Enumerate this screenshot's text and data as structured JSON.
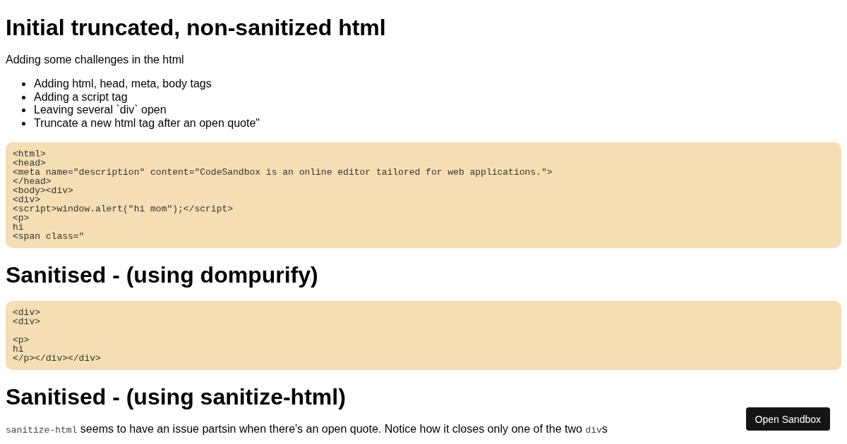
{
  "sections": [
    {
      "heading": "Initial truncated, non-sanitized html",
      "blocks": [
        {
          "kind": "paragraph",
          "parts": [
            {
              "kind": "text",
              "text": "Adding some challenges in the html"
            }
          ]
        },
        {
          "kind": "list",
          "items": [
            "Adding html, head, meta, body tags",
            "Adding a script tag",
            "Leaving several `div` open",
            "Truncate a new html tag after an open quote\""
          ]
        },
        {
          "kind": "code",
          "text": "<html>\n<head>\n<meta name=\"description\" content=\"CodeSandbox is an online editor tailored for web applications.\">\n</head>\n<body><div>\n<div>\n<script>window.alert(\"hi mom\");</script>\n<p>\nhi\n<span class=\""
        }
      ]
    },
    {
      "heading": "Sanitised - (using dompurify)",
      "blocks": [
        {
          "kind": "code",
          "text": "<div>\n<div>\n\n<p>\nhi\n</p></div></div>"
        }
      ]
    },
    {
      "heading": "Sanitised - (using sanitize-html)",
      "blocks": [
        {
          "kind": "paragraph",
          "parts": [
            {
              "kind": "code",
              "text": "sanitize-html"
            },
            {
              "kind": "text",
              "text": " seems to have an issue partsin when there's an open quote. Notice how it closes only one of the two "
            },
            {
              "kind": "code",
              "text": "div"
            },
            {
              "kind": "text",
              "text": "s"
            }
          ]
        }
      ]
    }
  ],
  "button": {
    "label": "Open Sandbox"
  }
}
